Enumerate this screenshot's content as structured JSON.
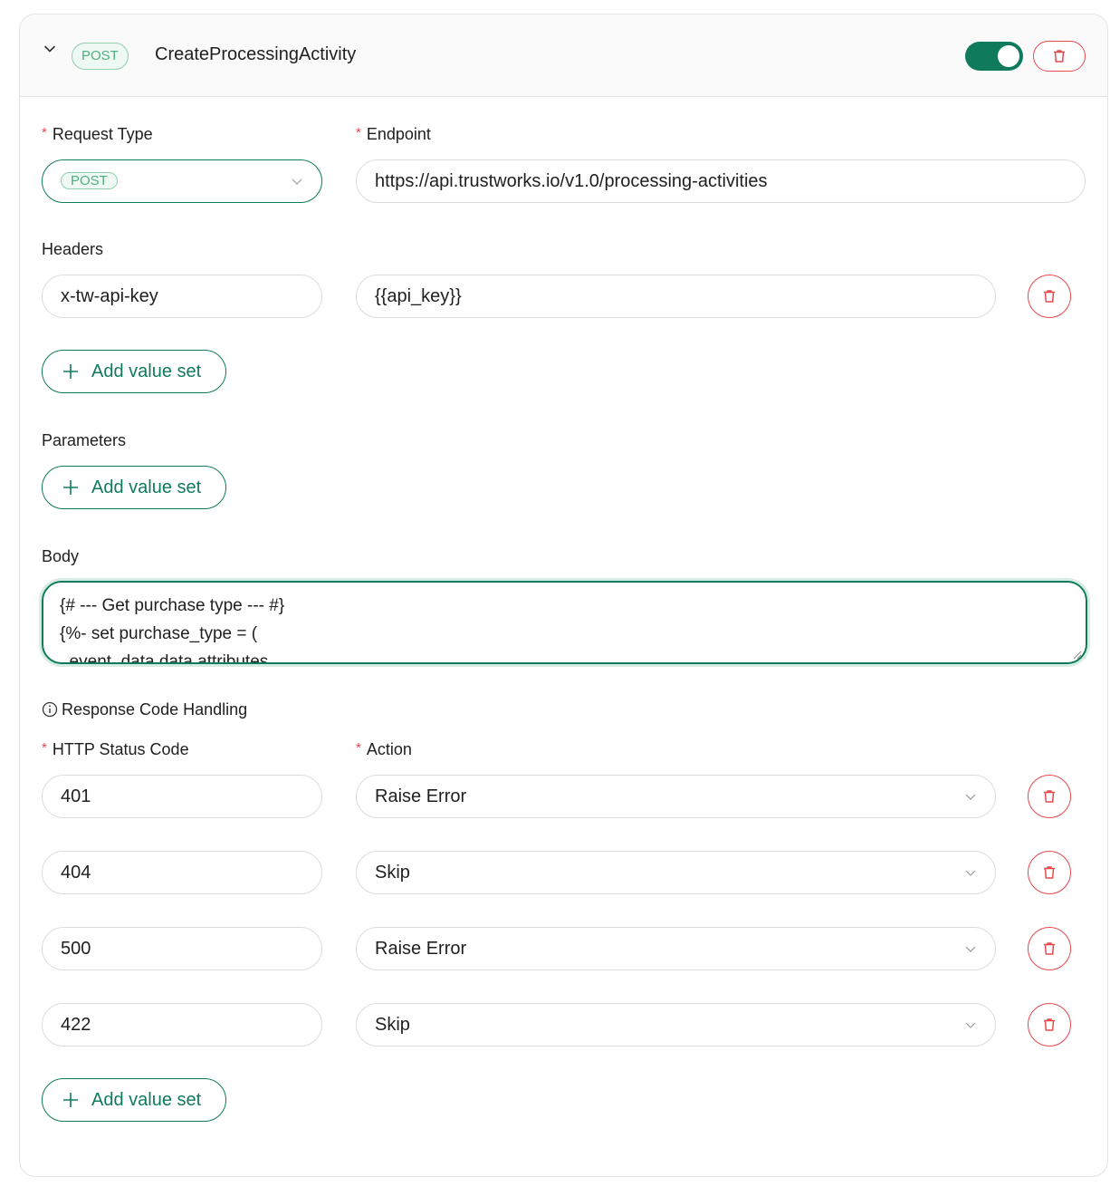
{
  "header": {
    "method_badge": "POST",
    "title": "CreateProcessingActivity",
    "enabled": true,
    "icons": {
      "collapse": "chevron-down-icon",
      "delete": "trash-icon"
    }
  },
  "request": {
    "request_type_label": "Request Type",
    "request_type_value": "POST",
    "endpoint_label": "Endpoint",
    "endpoint_value": "https://api.trustworks.io/v1.0/processing-activities",
    "required_marker": "*"
  },
  "headers": {
    "label": "Headers",
    "rows": [
      {
        "key": "x-tw-api-key",
        "value": "{{api_key}}"
      }
    ],
    "add_label": "Add value set"
  },
  "parameters": {
    "label": "Parameters",
    "add_label": "Add value set"
  },
  "body": {
    "label": "Body",
    "lines": [
      "{# --- Get purchase type --- #}",
      "{%- set purchase_type = (",
      "  event_data.data.attributes."
    ]
  },
  "response_handling": {
    "label": "Response Code Handling",
    "status_label": "HTTP Status Code",
    "action_label": "Action",
    "rows": [
      {
        "code": "401",
        "action": "Raise Error"
      },
      {
        "code": "404",
        "action": "Skip"
      },
      {
        "code": "500",
        "action": "Raise Error"
      },
      {
        "code": "422",
        "action": "Skip"
      }
    ],
    "add_label": "Add value set"
  },
  "colors": {
    "accent": "#107a5c",
    "danger": "#e5484d",
    "badge_text": "#4fae7f"
  }
}
